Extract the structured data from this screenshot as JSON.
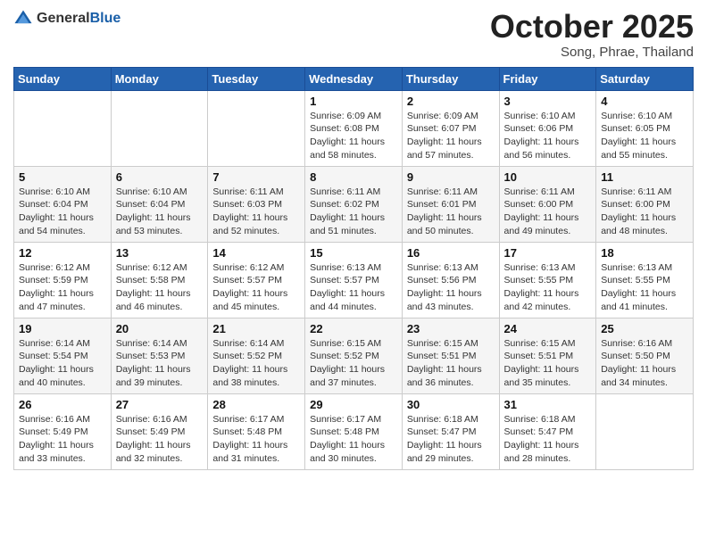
{
  "header": {
    "logo_general": "General",
    "logo_blue": "Blue",
    "month_title": "October 2025",
    "location": "Song, Phrae, Thailand"
  },
  "weekdays": [
    "Sunday",
    "Monday",
    "Tuesday",
    "Wednesday",
    "Thursday",
    "Friday",
    "Saturday"
  ],
  "weeks": [
    [
      {
        "day": "",
        "sunrise": "",
        "sunset": "",
        "daylight": ""
      },
      {
        "day": "",
        "sunrise": "",
        "sunset": "",
        "daylight": ""
      },
      {
        "day": "",
        "sunrise": "",
        "sunset": "",
        "daylight": ""
      },
      {
        "day": "1",
        "sunrise": "Sunrise: 6:09 AM",
        "sunset": "Sunset: 6:08 PM",
        "daylight": "Daylight: 11 hours and 58 minutes."
      },
      {
        "day": "2",
        "sunrise": "Sunrise: 6:09 AM",
        "sunset": "Sunset: 6:07 PM",
        "daylight": "Daylight: 11 hours and 57 minutes."
      },
      {
        "day": "3",
        "sunrise": "Sunrise: 6:10 AM",
        "sunset": "Sunset: 6:06 PM",
        "daylight": "Daylight: 11 hours and 56 minutes."
      },
      {
        "day": "4",
        "sunrise": "Sunrise: 6:10 AM",
        "sunset": "Sunset: 6:05 PM",
        "daylight": "Daylight: 11 hours and 55 minutes."
      }
    ],
    [
      {
        "day": "5",
        "sunrise": "Sunrise: 6:10 AM",
        "sunset": "Sunset: 6:04 PM",
        "daylight": "Daylight: 11 hours and 54 minutes."
      },
      {
        "day": "6",
        "sunrise": "Sunrise: 6:10 AM",
        "sunset": "Sunset: 6:04 PM",
        "daylight": "Daylight: 11 hours and 53 minutes."
      },
      {
        "day": "7",
        "sunrise": "Sunrise: 6:11 AM",
        "sunset": "Sunset: 6:03 PM",
        "daylight": "Daylight: 11 hours and 52 minutes."
      },
      {
        "day": "8",
        "sunrise": "Sunrise: 6:11 AM",
        "sunset": "Sunset: 6:02 PM",
        "daylight": "Daylight: 11 hours and 51 minutes."
      },
      {
        "day": "9",
        "sunrise": "Sunrise: 6:11 AM",
        "sunset": "Sunset: 6:01 PM",
        "daylight": "Daylight: 11 hours and 50 minutes."
      },
      {
        "day": "10",
        "sunrise": "Sunrise: 6:11 AM",
        "sunset": "Sunset: 6:00 PM",
        "daylight": "Daylight: 11 hours and 49 minutes."
      },
      {
        "day": "11",
        "sunrise": "Sunrise: 6:11 AM",
        "sunset": "Sunset: 6:00 PM",
        "daylight": "Daylight: 11 hours and 48 minutes."
      }
    ],
    [
      {
        "day": "12",
        "sunrise": "Sunrise: 6:12 AM",
        "sunset": "Sunset: 5:59 PM",
        "daylight": "Daylight: 11 hours and 47 minutes."
      },
      {
        "day": "13",
        "sunrise": "Sunrise: 6:12 AM",
        "sunset": "Sunset: 5:58 PM",
        "daylight": "Daylight: 11 hours and 46 minutes."
      },
      {
        "day": "14",
        "sunrise": "Sunrise: 6:12 AM",
        "sunset": "Sunset: 5:57 PM",
        "daylight": "Daylight: 11 hours and 45 minutes."
      },
      {
        "day": "15",
        "sunrise": "Sunrise: 6:13 AM",
        "sunset": "Sunset: 5:57 PM",
        "daylight": "Daylight: 11 hours and 44 minutes."
      },
      {
        "day": "16",
        "sunrise": "Sunrise: 6:13 AM",
        "sunset": "Sunset: 5:56 PM",
        "daylight": "Daylight: 11 hours and 43 minutes."
      },
      {
        "day": "17",
        "sunrise": "Sunrise: 6:13 AM",
        "sunset": "Sunset: 5:55 PM",
        "daylight": "Daylight: 11 hours and 42 minutes."
      },
      {
        "day": "18",
        "sunrise": "Sunrise: 6:13 AM",
        "sunset": "Sunset: 5:55 PM",
        "daylight": "Daylight: 11 hours and 41 minutes."
      }
    ],
    [
      {
        "day": "19",
        "sunrise": "Sunrise: 6:14 AM",
        "sunset": "Sunset: 5:54 PM",
        "daylight": "Daylight: 11 hours and 40 minutes."
      },
      {
        "day": "20",
        "sunrise": "Sunrise: 6:14 AM",
        "sunset": "Sunset: 5:53 PM",
        "daylight": "Daylight: 11 hours and 39 minutes."
      },
      {
        "day": "21",
        "sunrise": "Sunrise: 6:14 AM",
        "sunset": "Sunset: 5:52 PM",
        "daylight": "Daylight: 11 hours and 38 minutes."
      },
      {
        "day": "22",
        "sunrise": "Sunrise: 6:15 AM",
        "sunset": "Sunset: 5:52 PM",
        "daylight": "Daylight: 11 hours and 37 minutes."
      },
      {
        "day": "23",
        "sunrise": "Sunrise: 6:15 AM",
        "sunset": "Sunset: 5:51 PM",
        "daylight": "Daylight: 11 hours and 36 minutes."
      },
      {
        "day": "24",
        "sunrise": "Sunrise: 6:15 AM",
        "sunset": "Sunset: 5:51 PM",
        "daylight": "Daylight: 11 hours and 35 minutes."
      },
      {
        "day": "25",
        "sunrise": "Sunrise: 6:16 AM",
        "sunset": "Sunset: 5:50 PM",
        "daylight": "Daylight: 11 hours and 34 minutes."
      }
    ],
    [
      {
        "day": "26",
        "sunrise": "Sunrise: 6:16 AM",
        "sunset": "Sunset: 5:49 PM",
        "daylight": "Daylight: 11 hours and 33 minutes."
      },
      {
        "day": "27",
        "sunrise": "Sunrise: 6:16 AM",
        "sunset": "Sunset: 5:49 PM",
        "daylight": "Daylight: 11 hours and 32 minutes."
      },
      {
        "day": "28",
        "sunrise": "Sunrise: 6:17 AM",
        "sunset": "Sunset: 5:48 PM",
        "daylight": "Daylight: 11 hours and 31 minutes."
      },
      {
        "day": "29",
        "sunrise": "Sunrise: 6:17 AM",
        "sunset": "Sunset: 5:48 PM",
        "daylight": "Daylight: 11 hours and 30 minutes."
      },
      {
        "day": "30",
        "sunrise": "Sunrise: 6:18 AM",
        "sunset": "Sunset: 5:47 PM",
        "daylight": "Daylight: 11 hours and 29 minutes."
      },
      {
        "day": "31",
        "sunrise": "Sunrise: 6:18 AM",
        "sunset": "Sunset: 5:47 PM",
        "daylight": "Daylight: 11 hours and 28 minutes."
      },
      {
        "day": "",
        "sunrise": "",
        "sunset": "",
        "daylight": ""
      }
    ]
  ]
}
